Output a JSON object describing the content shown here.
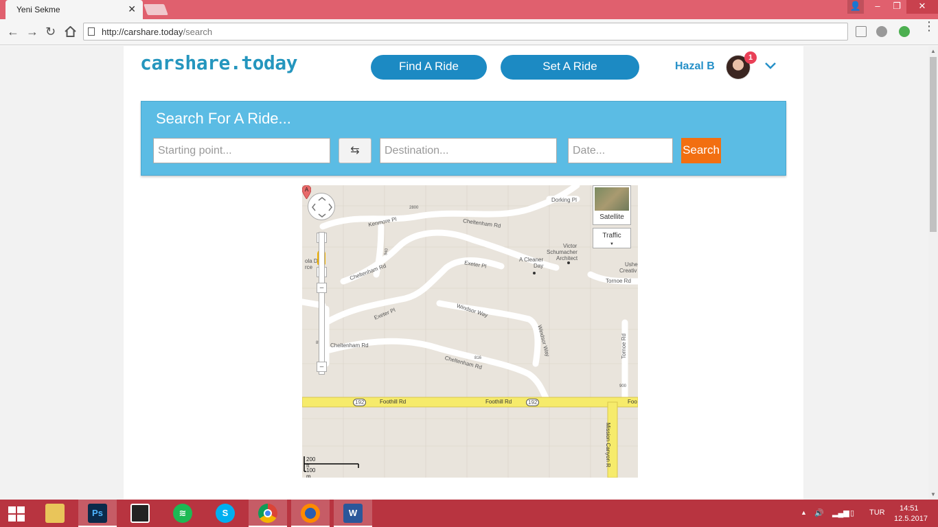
{
  "browser": {
    "tab_title": "Yeni Sekme",
    "url_host": "http://carshare.today",
    "url_path": "/search"
  },
  "header": {
    "logo": "carshare.today",
    "find_ride": "Find A Ride",
    "set_ride": "Set A Ride",
    "username": "Hazal B",
    "notification_count": "1"
  },
  "search": {
    "title": "Search For A Ride...",
    "start_placeholder": "Starting point...",
    "destination_placeholder": "Destination...",
    "date_placeholder": "Date...",
    "button_label": "Search",
    "swap_icon": "swap-icon"
  },
  "map": {
    "satellite_label": "Satellite",
    "traffic_label": "Traffic",
    "marker_letter": "A",
    "scale_ft": "200 ft",
    "scale_m": "100 m",
    "labels": {
      "dorking": "Dorking Pl",
      "cheltenham_top": "Cheltenham Rd",
      "kenmore": "Kenmore Pl",
      "n2800": "2800",
      "victor": "Victor",
      "schumacher": "Schumacher",
      "architect": "Architect",
      "cleaner": "A Cleaner",
      "day": "Day",
      "ushe": "Ushe",
      "creativ": "Creativ",
      "tornoe_top": "Tornoe Rd",
      "exeter_top": "Exeter Pl",
      "cheltenham_mid": "Cheltenham Rd",
      "n940": "940",
      "ola": "ola D",
      "rce": "rce",
      "windsor_way": "Windsor Way",
      "windsor_vert": "Windsor Way",
      "exeter_mid": "Exeter Pl",
      "cheltenham_low": "Cheltenham Rd",
      "cheltenham_bot": "Cheltenham Rd",
      "n816": "816",
      "n852": "852",
      "tornoe_vert": "Tornoe Rd",
      "n900": "900",
      "foothill_1": "Foothill Rd",
      "foothill_2": "Foothill Rd",
      "route1": "192",
      "route2": "192",
      "foo": "Foo",
      "mission": "Mission Canyon R"
    }
  },
  "taskbar": {
    "language": "TUR",
    "time": "14:51",
    "date": "12.5.2017"
  }
}
